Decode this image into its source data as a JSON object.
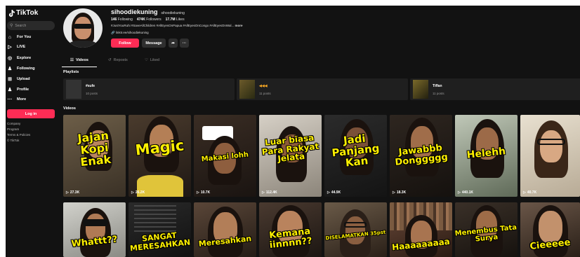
{
  "sidebar": {
    "logo": "TikTok",
    "search_placeholder": "Search",
    "nav": [
      {
        "label": "For You",
        "icon": "home-icon"
      },
      {
        "label": "LIVE",
        "icon": "live-icon"
      },
      {
        "label": "Explore",
        "icon": "compass-icon"
      },
      {
        "label": "Following",
        "icon": "person-icon"
      },
      {
        "label": "Upload",
        "icon": "upload-icon"
      },
      {
        "label": "Profile",
        "icon": "profile-icon"
      },
      {
        "label": "More",
        "icon": "more-icon"
      }
    ],
    "login": "Log in",
    "footer": [
      "Company",
      "Program",
      "Terms & Policies",
      "© TikTok"
    ]
  },
  "profile": {
    "username": "sihoodiekuning",
    "nickname": "sihoodiekuning",
    "following": "146",
    "following_label": "Following",
    "followers": "474K",
    "followers_label": "Followers",
    "likes": "17.7M",
    "likes_label": "Likes",
    "bio": "#JustYouRuhi #SaveAllChildren #AllEyesOnPapua #AllEyesOnCongo #AllEyesOnWal...",
    "bio_more": "more",
    "link": "linktr.ee/sihoodiekuning",
    "follow": "Follow",
    "message": "Message"
  },
  "tabs": [
    "Videos",
    "Reposts",
    "Liked"
  ],
  "playlists_title": "Playlists",
  "playlists": [
    {
      "title": "#sufe",
      "count": "10 posts"
    },
    {
      "title": "",
      "count": "11 posts"
    },
    {
      "title": "Tiffan",
      "count": "11 posts"
    }
  ],
  "videos_title": "Videos",
  "videos": [
    {
      "caption": "Jajan Kopi Enak",
      "views": "27.3K"
    },
    {
      "caption": "Magic",
      "views": "26.2K"
    },
    {
      "caption": "Makasi lohh",
      "views": "10.7K"
    },
    {
      "caption": "Luar biasa Para Rakyat Jelata",
      "views": "112.4K"
    },
    {
      "caption": "Jadi Panjang Kan",
      "views": "44.9K"
    },
    {
      "caption": "Jawabbb Donggggg",
      "views": "18.3K"
    },
    {
      "caption": "Helehh",
      "views": "440.1K"
    },
    {
      "caption": "",
      "views": "40.7K"
    },
    {
      "caption": "Whattt??",
      "views": ""
    },
    {
      "caption": "SANGAT MERESAHKAN",
      "views": ""
    },
    {
      "caption": "Meresahkan",
      "views": ""
    },
    {
      "caption": "Kemana iinnnn??",
      "views": ""
    },
    {
      "caption": "DISELAMATKAN 35pst",
      "views": ""
    },
    {
      "caption": "Haaaaaaaaa",
      "views": ""
    },
    {
      "caption": "Menembus Tata Surya",
      "views": ""
    },
    {
      "caption": "Cieeeee",
      "views": ""
    }
  ],
  "colors": {
    "accent": "#fe2c55",
    "caption": "#fff000",
    "bg": "#121212"
  }
}
